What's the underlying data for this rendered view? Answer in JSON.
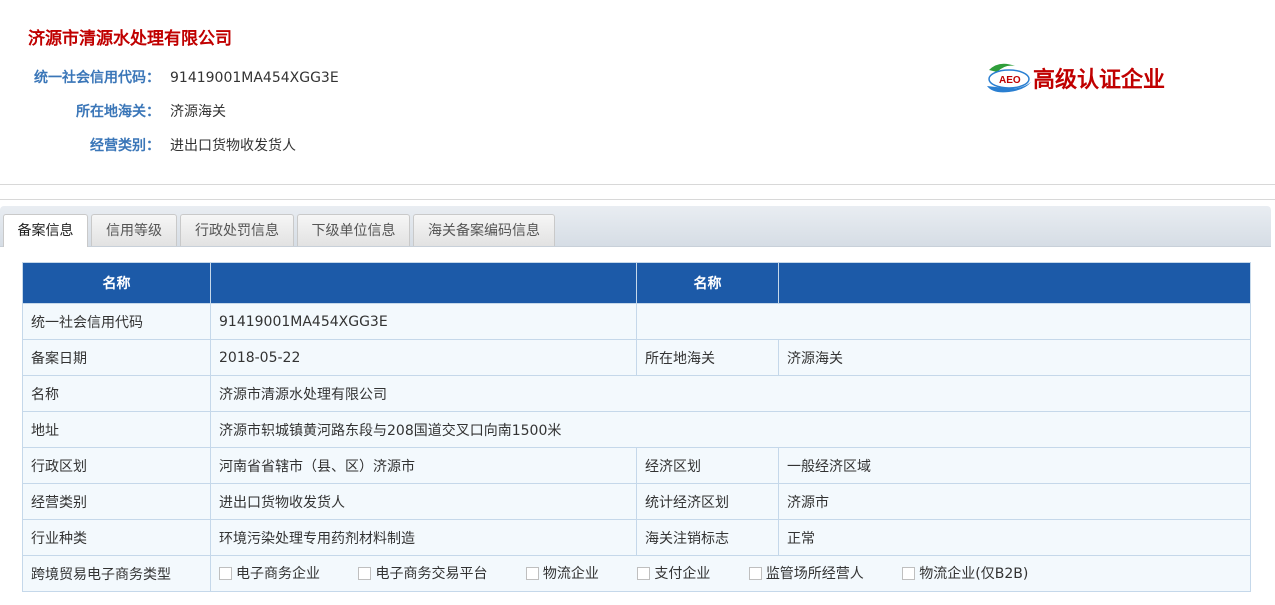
{
  "company": {
    "name": "济源市清源水处理有限公司",
    "info": [
      {
        "label": "统一社会信用代码：",
        "value": "91419001MA454XGG3E"
      },
      {
        "label": "所在地海关：",
        "value": "济源海关"
      },
      {
        "label": "经营类别：",
        "value": "进出口货物收发货人"
      }
    ]
  },
  "badge": {
    "logo_text": "AEO",
    "text": "高级认证企业",
    "icon": "aeo-logo-icon",
    "color": "#c00000"
  },
  "tabs": [
    {
      "label": "备案信息",
      "active": true
    },
    {
      "label": "信用等级",
      "active": false
    },
    {
      "label": "行政处罚信息",
      "active": false
    },
    {
      "label": "下级单位信息",
      "active": false
    },
    {
      "label": "海关备案编码信息",
      "active": false
    }
  ],
  "table": {
    "header": {
      "col1": "名称",
      "col3": "名称"
    },
    "rows": {
      "credit_code": {
        "label": "统一社会信用代码",
        "value": "91419001MA454XGG3E"
      },
      "reg_date": {
        "label": "备案日期",
        "value": "2018-05-22",
        "label2": "所在地海关",
        "value2": "济源海关"
      },
      "name": {
        "label": "名称",
        "value": "济源市清源水处理有限公司"
      },
      "address": {
        "label": "地址",
        "value": "济源市轵城镇黄河路东段与208国道交叉口向南1500米"
      },
      "admin_region": {
        "label": "行政区划",
        "value": "河南省省辖市（县、区）济源市",
        "label2": "经济区划",
        "value2": "一般经济区域"
      },
      "biz_category": {
        "label": "经营类别",
        "value": "进出口货物收发货人",
        "label2": "统计经济区划",
        "value2": "济源市"
      },
      "industry": {
        "label": "行业种类",
        "value": "环境污染处理专用药剂材料制造",
        "label2": "海关注销标志",
        "value2": "正常"
      },
      "ecommerce": {
        "label": "跨境贸易电子商务类型",
        "options": [
          "电子商务企业",
          "电子商务交易平台",
          "物流企业",
          "支付企业",
          "监管场所经营人",
          "物流企业(仅B2B)"
        ]
      }
    }
  },
  "colors": {
    "accent": "#1c5aa8",
    "label_blue": "#3a76b8",
    "company_red": "#c00000"
  }
}
